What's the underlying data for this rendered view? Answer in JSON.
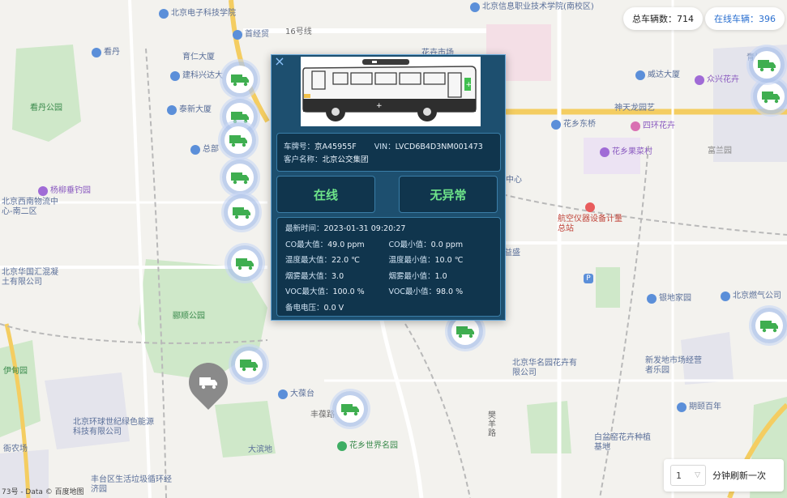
{
  "map": {
    "pois": [
      {
        "name": "北京电子科技学院",
        "icon": "school-icon"
      },
      {
        "name": "北京信息职业技术学院(南校区)",
        "icon": "school-icon"
      },
      {
        "name": "看丹",
        "icon": "subway-icon"
      },
      {
        "name": "首经贸",
        "icon": "subway-icon"
      },
      {
        "name": "16号线",
        "icon": "metro-line-icon"
      },
      {
        "name": "育仁大厦",
        "icon": "building-icon"
      },
      {
        "name": "建科兴达大",
        "icon": "building-icon"
      },
      {
        "name": "泰新大厦",
        "icon": "building-icon"
      },
      {
        "name": "总部",
        "icon": "building-icon"
      },
      {
        "name": "看丹公园",
        "icon": "park-icon"
      },
      {
        "name": "杨柳垂钓园",
        "icon": "fishing-icon"
      },
      {
        "name": "北京西南物流中心-南二区",
        "icon": "logistics-icon"
      },
      {
        "name": "北京华国汇混凝土有限公司",
        "icon": "company-icon"
      },
      {
        "name": "郦顺公园",
        "icon": "park-icon"
      },
      {
        "name": "伊甸园",
        "icon": "park-icon"
      },
      {
        "name": "北京环球世纪绿色能源科技有限公司",
        "icon": "company-icon"
      },
      {
        "name": "大葆台",
        "icon": "subway-icon"
      },
      {
        "name": "丰葆路",
        "icon": "road-icon"
      },
      {
        "name": "大滨地",
        "icon": "building-icon"
      },
      {
        "name": "花乡世界名园",
        "icon": "park-icon"
      },
      {
        "name": "丰台区生活垃圾循环经济园",
        "icon": "company-icon"
      },
      {
        "name": "花卉市场",
        "icon": "market-icon"
      },
      {
        "name": "威达大厦",
        "icon": "building-icon"
      },
      {
        "name": "众兴花卉",
        "icon": "shop-icon"
      },
      {
        "name": "神天龙园艺",
        "icon": "shop-icon"
      },
      {
        "name": "花乡东桥",
        "icon": "subway-icon"
      },
      {
        "name": "四环花卉",
        "icon": "shop-icon"
      },
      {
        "name": "花乡果菜村",
        "icon": "shop-icon"
      },
      {
        "name": "富兰园",
        "icon": "area-icon"
      },
      {
        "name": "航空仪器设备计量总站",
        "icon": "pin-icon"
      },
      {
        "name": "益盛",
        "icon": "building-icon"
      },
      {
        "name": "P",
        "icon": "parking-icon"
      },
      {
        "name": "银地家园",
        "icon": "building-icon"
      },
      {
        "name": "北京燃气公司",
        "icon": "building-icon"
      },
      {
        "name": "北京华名园花卉有限公司",
        "icon": "company-icon"
      },
      {
        "name": "新发地市场经营者乐园",
        "icon": "building-icon"
      },
      {
        "name": "期颐百年",
        "icon": "building-icon"
      },
      {
        "name": "白盆窑花卉种植基地",
        "icon": "building-icon"
      },
      {
        "name": "樊羊路",
        "icon": "road-icon"
      },
      {
        "name": "青片",
        "icon": "building-icon"
      },
      {
        "name": "中心",
        "icon": "building-icon"
      },
      {
        "name": "衙农场",
        "icon": "building-icon"
      }
    ],
    "attribution": "73号 - Data © 百度地图"
  },
  "counters": {
    "total_label": "总车辆数：",
    "total_value": "714",
    "online_label": "在线车辆：",
    "online_value": "396"
  },
  "refresh": {
    "interval_value": "1",
    "suffix": "分钟刷新一次"
  },
  "popup": {
    "close_icon": "×",
    "plate_label": "车牌号：",
    "plate_value": "京A45955F",
    "vin_label": "VIN：",
    "vin_value": "LVCD6B4D3NM001473",
    "customer_label": "客户名称：",
    "customer_value": "北京公交集团",
    "status_online": "在线",
    "status_abnormal": "无异常",
    "latest_time_label": "最新时间：",
    "latest_time_value": "2023-01-31 09:20:27",
    "co_max_label": "CO最大值：",
    "co_max_value": "49.0 ppm",
    "co_min_label": "CO最小值：",
    "co_min_value": "0.0 ppm",
    "temp_max_label": "温度最大值：",
    "temp_max_value": "22.0 ℃",
    "temp_min_label": "温度最小值：",
    "temp_min_value": "10.0 ℃",
    "smoke_max_label": "烟雾最大值：",
    "smoke_max_value": "3.0",
    "smoke_min_label": "烟雾最小值：",
    "smoke_min_value": "1.0",
    "voc_max_label": "VOC最大值：",
    "voc_max_value": "100.0 %",
    "voc_min_label": "VOC最小值：",
    "voc_min_value": "98.0 %",
    "battery_label": "备电电压：",
    "battery_value": "0.0 V"
  },
  "colors": {
    "popup_bg": "#1d4f6f",
    "status_text": "#6ee58a",
    "online_count": "#2a6fd0",
    "marker_truck": "#3fae50"
  }
}
